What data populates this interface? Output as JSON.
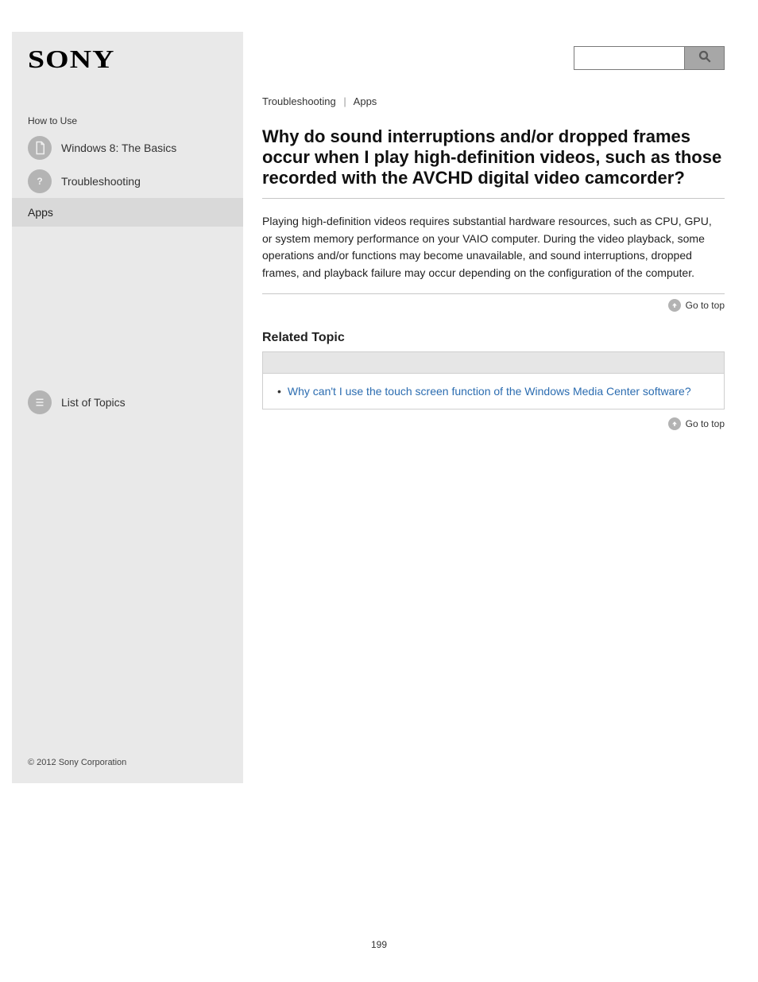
{
  "brand": "SONY",
  "sidebar": {
    "section_label": "How to Use",
    "rows": [
      {
        "label": "Windows 8: The Basics"
      },
      {
        "label": "Troubleshooting"
      }
    ],
    "active_item": "Apps",
    "toc_label": "List of Topics",
    "copyright": "© 2012 Sony Corporation"
  },
  "search": {
    "placeholder": ""
  },
  "breadcrumb": {
    "part1": "Troubleshooting",
    "part2": "Apps"
  },
  "article": {
    "title": "Why do sound interruptions and/or dropped frames occur when I play high-definition videos, such as those recorded with the AVCHD digital video camcorder?",
    "answer": "Playing high-definition videos requires substantial hardware resources, such as CPU, GPU, or system memory performance on your VAIO computer. During the video playback, some operations and/or functions may become unavailable, and sound interruptions, dropped frames, and playback failure may occur depending on the configuration of the computer.",
    "to_top": "Go to top"
  },
  "related": {
    "heading": "Related Topic",
    "items": [
      "Why can't I use the touch screen function of the Windows Media Center software?"
    ]
  },
  "page_number": "199"
}
